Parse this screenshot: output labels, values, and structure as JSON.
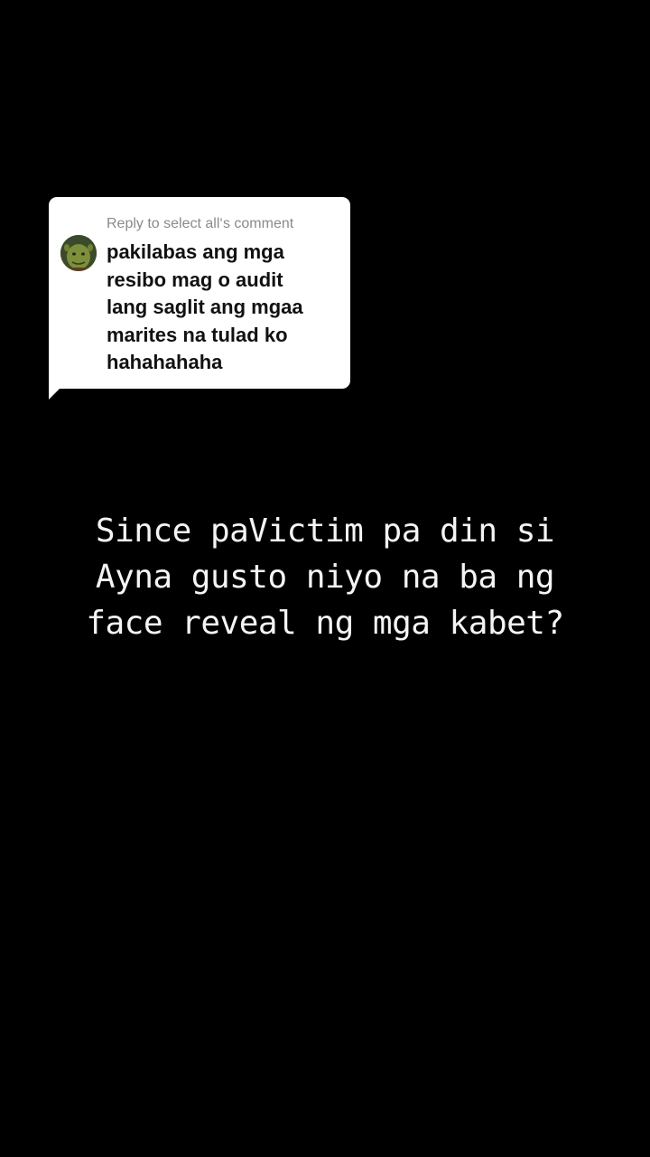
{
  "reply": {
    "header": "Reply to select all‘s comment",
    "comment_lines": [
      "pakilabas ang mga",
      "resibo mag o audit",
      "lang saglit ang mgaa",
      "marites na tulad ko",
      "hahahahaha"
    ],
    "avatar_icon": "shrek-avatar-icon"
  },
  "caption": {
    "lines": [
      "Since paVictim pa din si",
      "Ayna gusto niyo na ba ng",
      "face reveal ng mga kabet?"
    ]
  },
  "colors": {
    "background": "#000000",
    "bubble": "#ffffff",
    "header_text": "#8a8a8a",
    "comment_text": "#111111",
    "caption_text": "#f4f4f4"
  }
}
